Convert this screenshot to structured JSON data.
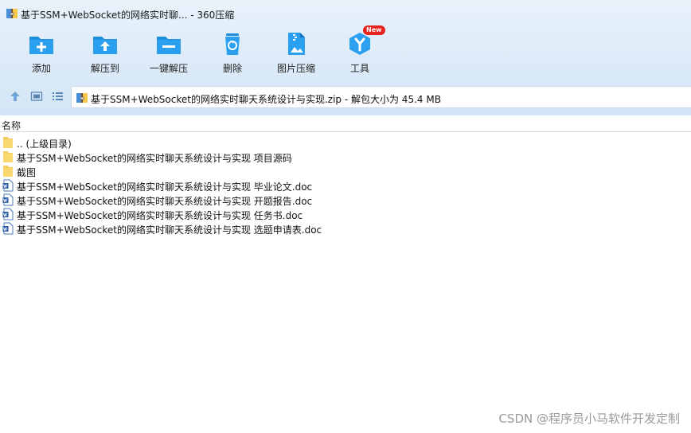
{
  "window": {
    "title": "基于SSM+WebSocket的网络实时聊... - 360压缩"
  },
  "toolbar": {
    "add_label": "添加",
    "extract_to_label": "解压到",
    "one_click_extract_label": "一键解压",
    "delete_label": "删除",
    "image_compress_label": "图片压缩",
    "tools_label": "工具",
    "tools_badge": "New"
  },
  "address": {
    "path": "基于SSM+WebSocket的网络实时聊天系统设计与实现.zip - 解包大小为 45.4 MB"
  },
  "filelist": {
    "column_name": "名称",
    "rows": [
      {
        "name": ".. (上级目录)",
        "type": "folder"
      },
      {
        "name": "基于SSM+WebSocket的网络实时聊天系统设计与实现 项目源码",
        "type": "folder"
      },
      {
        "name": "截图",
        "type": "folder"
      },
      {
        "name": "基于SSM+WebSocket的网络实时聊天系统设计与实现 毕业论文.doc",
        "type": "doc"
      },
      {
        "name": "基于SSM+WebSocket的网络实时聊天系统设计与实现 开题报告.doc",
        "type": "doc"
      },
      {
        "name": "基于SSM+WebSocket的网络实时聊天系统设计与实现 任务书.doc",
        "type": "doc"
      },
      {
        "name": "基于SSM+WebSocket的网络实时聊天系统设计与实现 选题申请表.doc",
        "type": "doc"
      }
    ]
  },
  "watermark": "CSDN @程序员小马软件开发定制",
  "colors": {
    "toolbar_bg": "#dbeaf8",
    "icon_blue": "#1e8fe1",
    "badge_red": "#e8231f"
  }
}
